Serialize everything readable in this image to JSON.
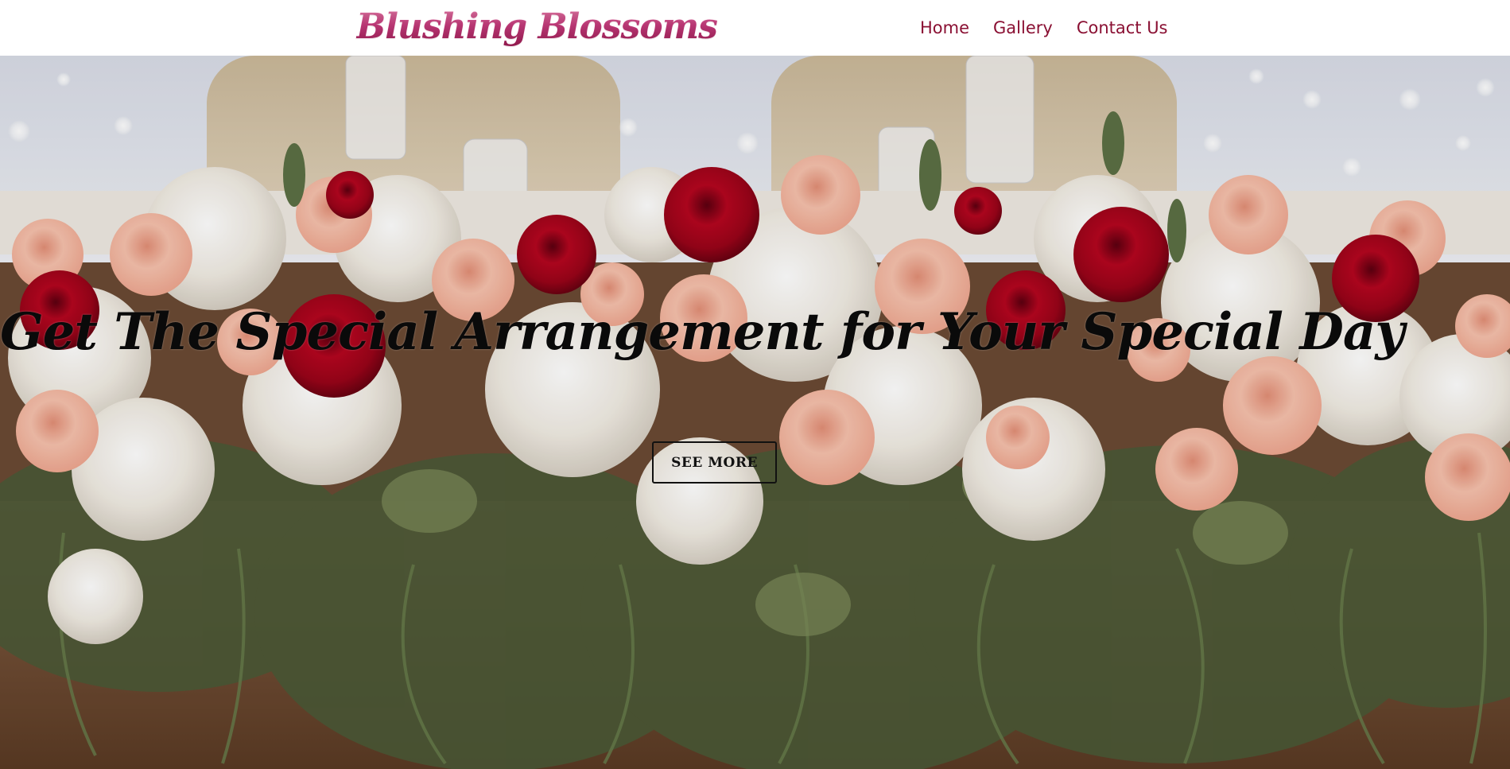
{
  "header": {
    "brand": "Blushing Blossoms",
    "nav": [
      {
        "label": "Home"
      },
      {
        "label": "Gallery"
      },
      {
        "label": "Contact Us"
      }
    ]
  },
  "hero": {
    "background_image": "floral-arrangement-photo",
    "title": "Get The Special Arrangement for Your Special Day",
    "button_label": "SEE MORE"
  },
  "colors": {
    "brand_gradient": [
      "#e58bb0",
      "#c43e7e",
      "#8d1548"
    ],
    "nav_link": "#8a1033",
    "hero_text": "#0a0a0a",
    "rose_red": "#a3001c",
    "rose_peach": "#f3b59e",
    "hydrangea_white": "#f3efe8",
    "foliage_green": "#4b5a37"
  }
}
